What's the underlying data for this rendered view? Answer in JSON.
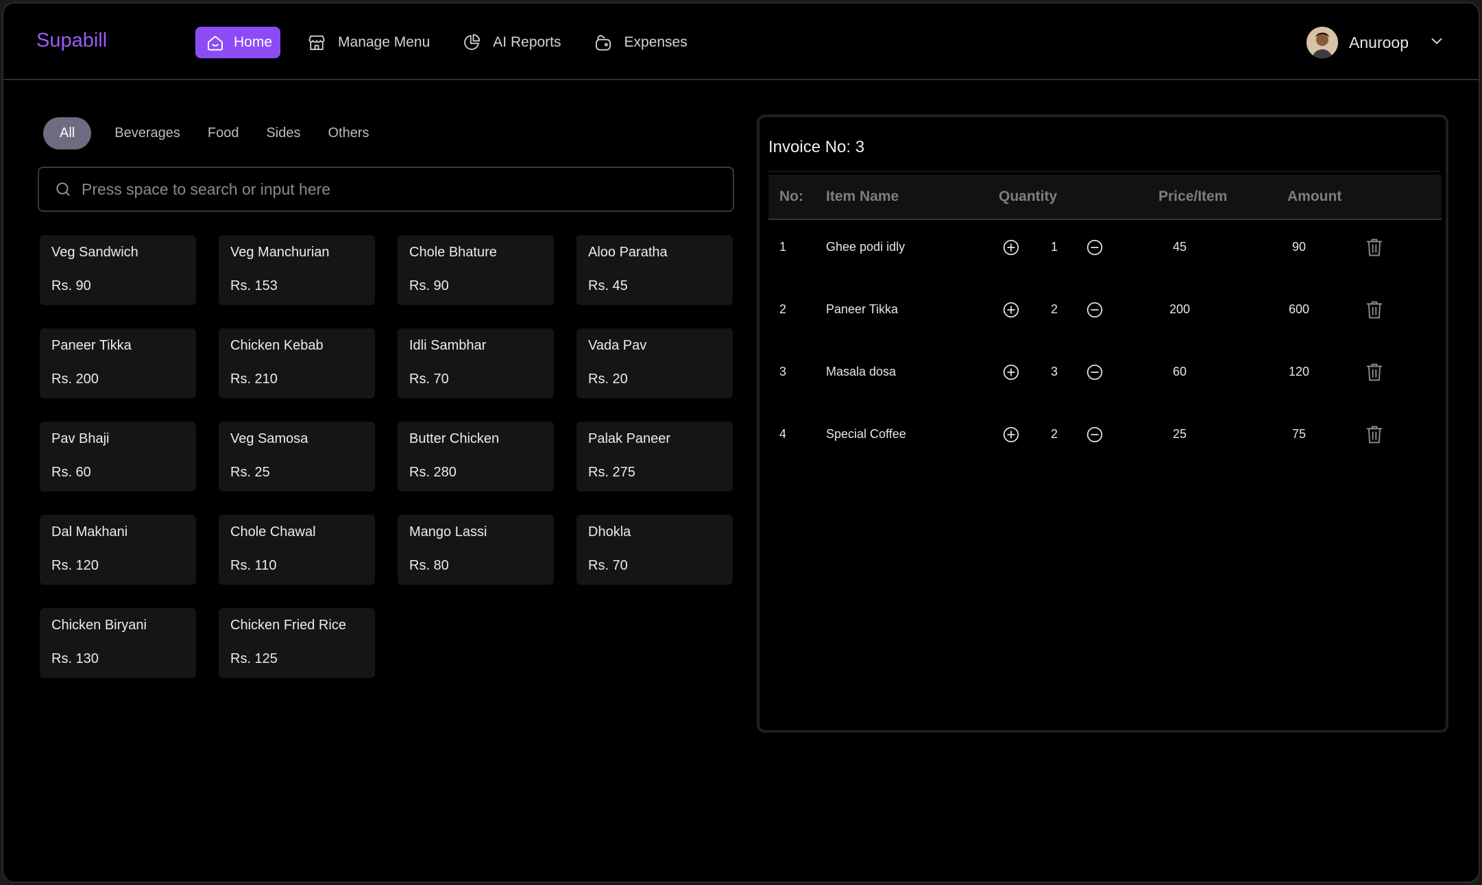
{
  "app": {
    "brand": "Supabill"
  },
  "nav": [
    {
      "label": "Home",
      "icon": "home-icon",
      "active": true
    },
    {
      "label": "Manage Menu",
      "icon": "store-icon",
      "active": false
    },
    {
      "label": "AI Reports",
      "icon": "pie-chart-icon",
      "active": false
    },
    {
      "label": "Expenses",
      "icon": "wallet-icon",
      "active": false
    }
  ],
  "user": {
    "name": "Anuroop"
  },
  "categories": {
    "tabs": [
      {
        "label": "All",
        "active": true
      },
      {
        "label": "Beverages",
        "active": false
      },
      {
        "label": "Food",
        "active": false
      },
      {
        "label": "Sides",
        "active": false
      },
      {
        "label": "Others",
        "active": false
      }
    ]
  },
  "search": {
    "placeholder": "Press space to search or input here",
    "value": ""
  },
  "menu_items": [
    {
      "name": "Veg Sandwich",
      "price": "Rs. 90"
    },
    {
      "name": "Veg Manchurian",
      "price": "Rs. 153"
    },
    {
      "name": "Chole Bhature",
      "price": "Rs. 90"
    },
    {
      "name": "Aloo Paratha",
      "price": "Rs. 45"
    },
    {
      "name": "Paneer Tikka",
      "price": "Rs. 200"
    },
    {
      "name": "Chicken Kebab",
      "price": "Rs. 210"
    },
    {
      "name": "Idli Sambhar",
      "price": "Rs. 70"
    },
    {
      "name": "Vada Pav",
      "price": "Rs. 20"
    },
    {
      "name": "Pav Bhaji",
      "price": "Rs. 60"
    },
    {
      "name": "Veg Samosa",
      "price": "Rs. 25"
    },
    {
      "name": "Butter Chicken",
      "price": "Rs. 280"
    },
    {
      "name": "Palak Paneer",
      "price": "Rs. 275"
    },
    {
      "name": "Dal Makhani",
      "price": "Rs. 120"
    },
    {
      "name": "Chole Chawal",
      "price": "Rs. 110"
    },
    {
      "name": "Mango Lassi",
      "price": "Rs. 80"
    },
    {
      "name": "Dhokla",
      "price": "Rs. 70"
    },
    {
      "name": "Chicken Biryani",
      "price": "Rs. 130"
    },
    {
      "name": "Chicken Fried Rice",
      "price": "Rs. 125"
    }
  ],
  "invoice": {
    "title": "Invoice No: 3",
    "columns": {
      "no": "No:",
      "item": "Item Name",
      "qty": "Quantity",
      "price": "Price/Item",
      "amount": "Amount"
    },
    "rows": [
      {
        "no": "1",
        "item": "Ghee podi idly",
        "qty": "1",
        "price": "45",
        "amount": "90"
      },
      {
        "no": "2",
        "item": "Paneer Tikka",
        "qty": "2",
        "price": "200",
        "amount": "600"
      },
      {
        "no": "3",
        "item": "Masala dosa",
        "qty": "3",
        "price": "60",
        "amount": "120"
      },
      {
        "no": "4",
        "item": "Special Coffee",
        "qty": "2",
        "price": "25",
        "amount": "75"
      }
    ]
  },
  "colors": {
    "accent": "#8b4cf5",
    "brand": "#9b5cf6",
    "background": "#000000",
    "card": "#151515"
  }
}
